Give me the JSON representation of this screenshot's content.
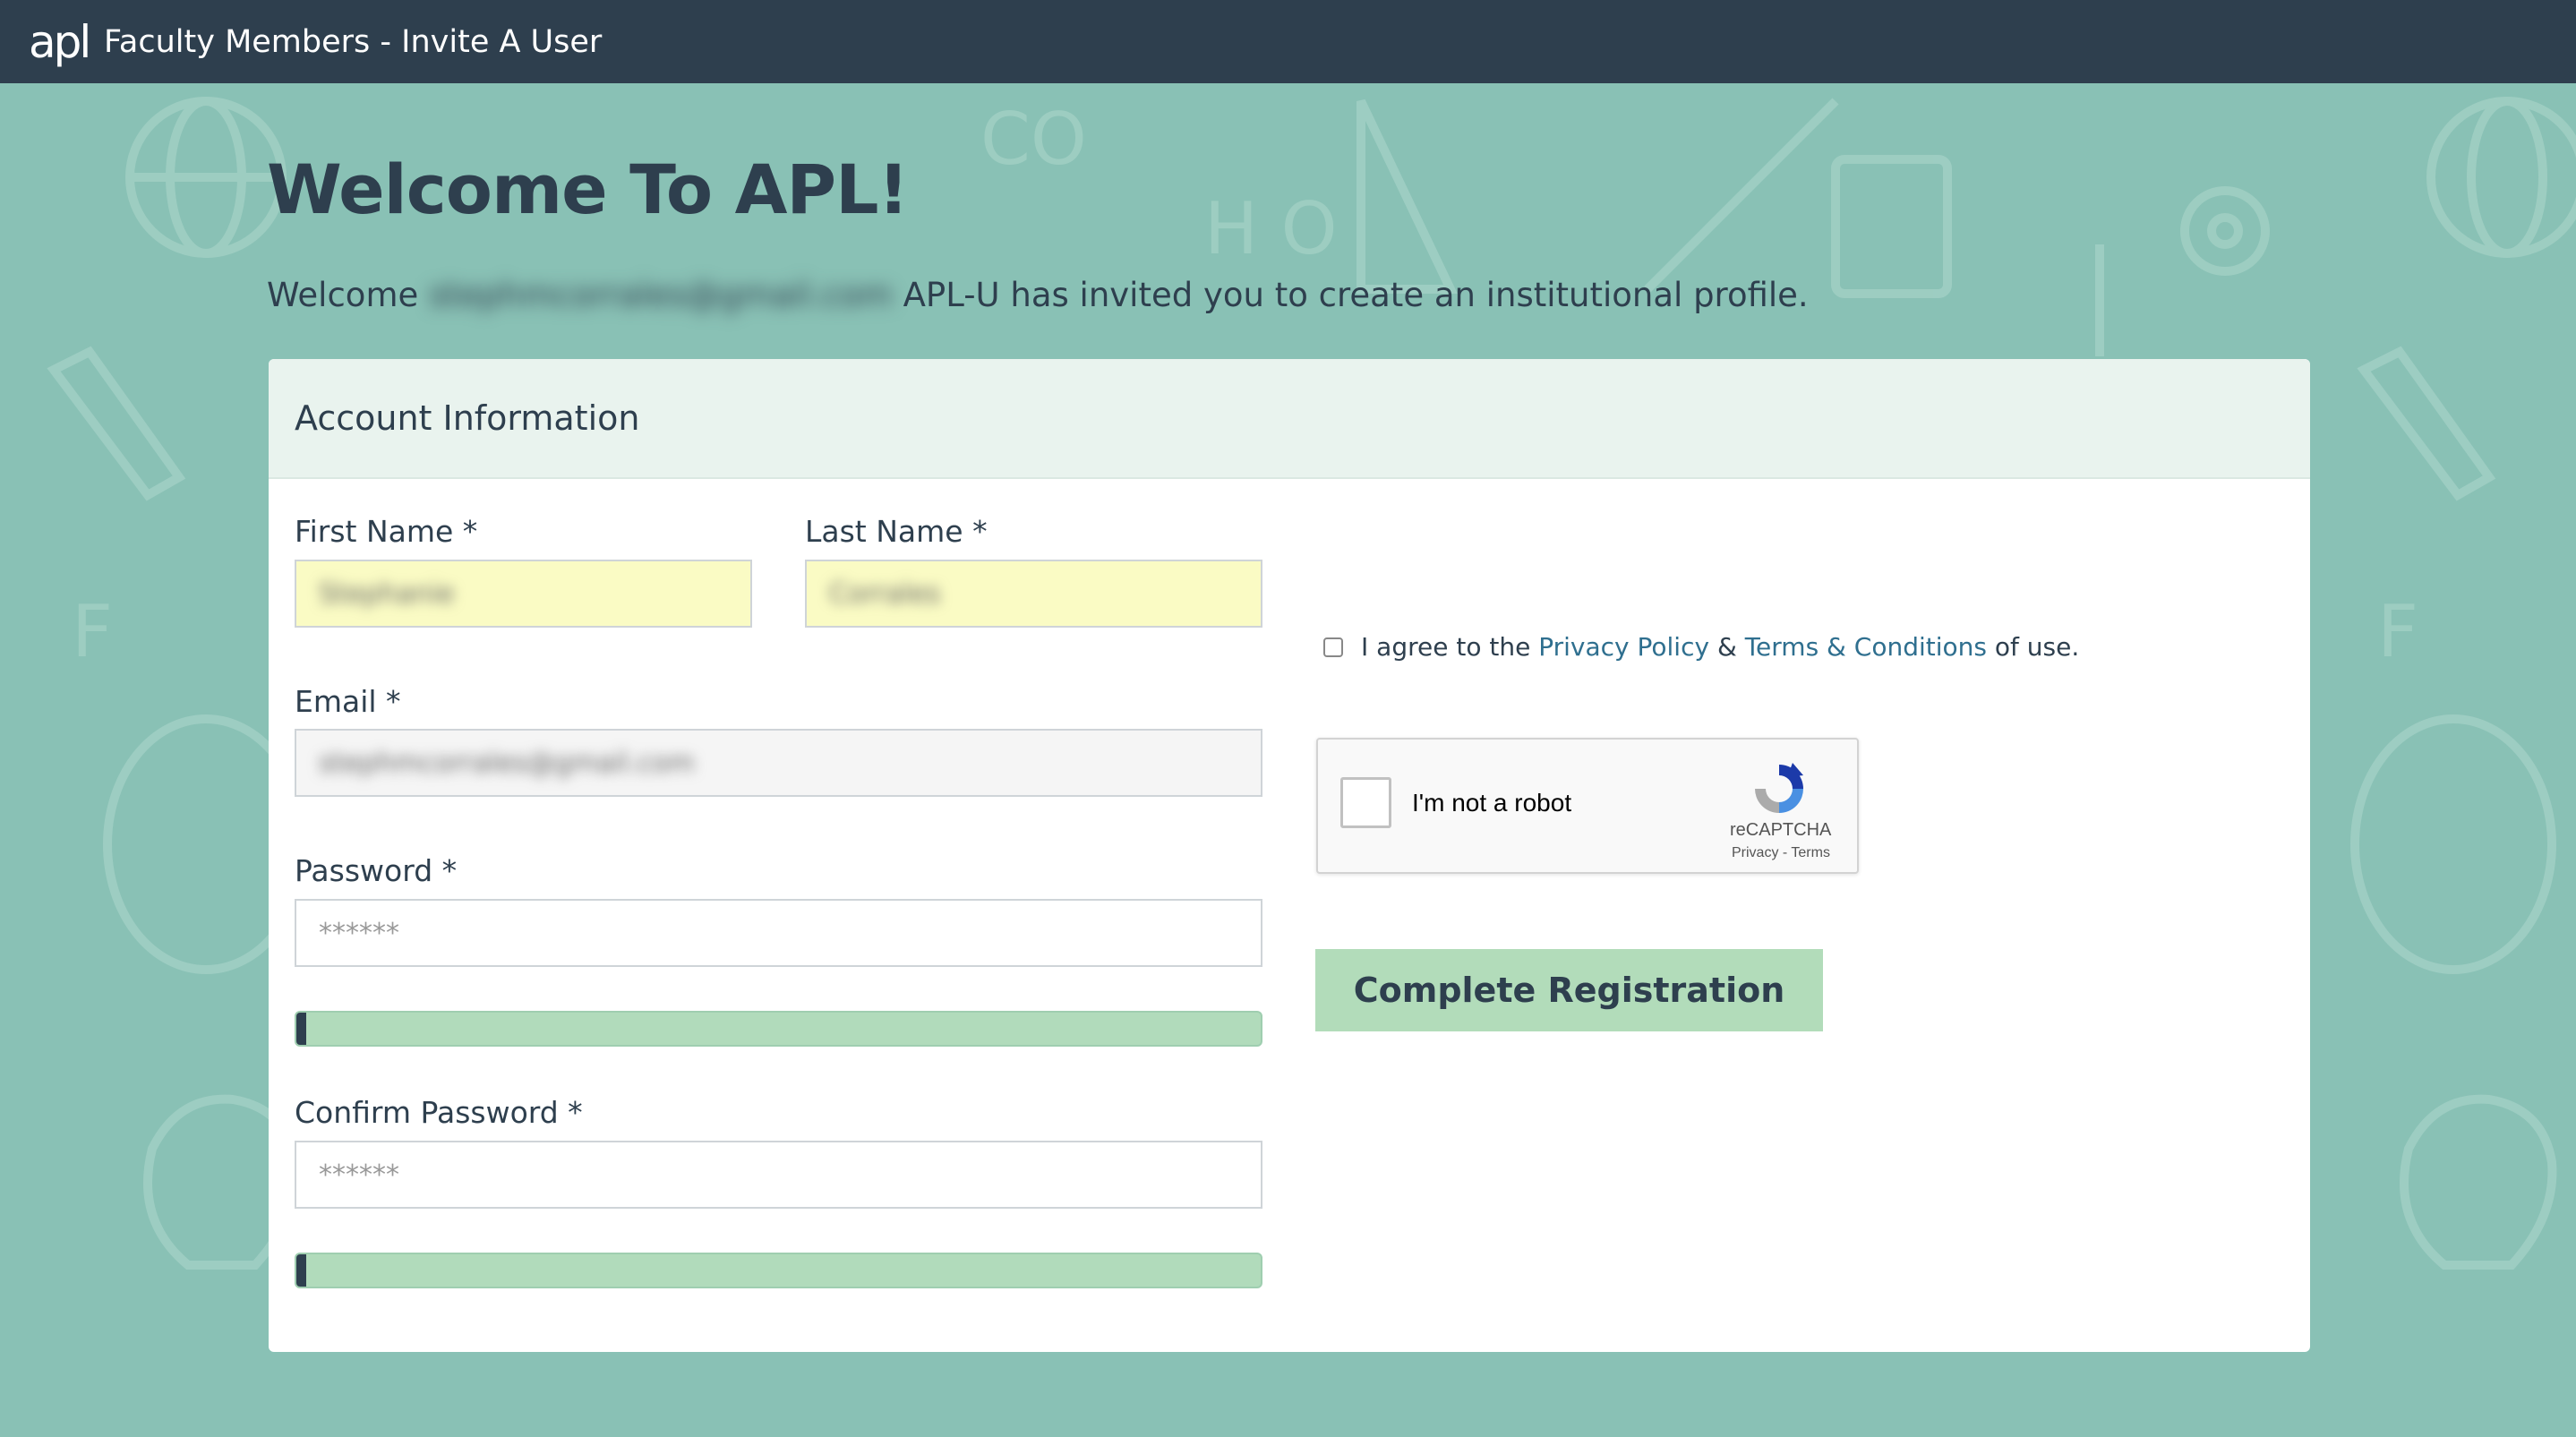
{
  "app": {
    "logo_text": "apl",
    "title": "Faculty Members - Invite A User"
  },
  "page": {
    "heading": "Welcome To APL!",
    "welcome_prefix": "Welcome",
    "welcome_email": "stephmcorrales@gmail.com",
    "welcome_suffix": "APL-U has invited you to create an institutional profile."
  },
  "card": {
    "header": "Account Information"
  },
  "form": {
    "first_name_label": "First Name *",
    "first_name_value": "Stephanie",
    "last_name_label": "Last Name *",
    "last_name_value": "Corrales",
    "email_label": "Email *",
    "email_value": "stephmcorrales@gmail.com",
    "password_label": "Password *",
    "password_placeholder": "******",
    "password_strength": 0.01,
    "confirm_label": "Confirm Password *",
    "confirm_placeholder": "******",
    "confirm_strength": 0.01
  },
  "agreement": {
    "prefix": "I agree to the",
    "privacy_link": "Privacy Policy",
    "ampersand": "&",
    "terms_link": "Terms & Conditions",
    "suffix": "of use."
  },
  "recaptcha": {
    "label": "I'm not a robot",
    "brand": "reCAPTCHA",
    "links": "Privacy - Terms"
  },
  "submit_label": "Complete Registration",
  "colors": {
    "topbar": "#2e3f4e",
    "background": "#89c1b5",
    "button": "#b2dcba",
    "link": "#2f6f8f"
  }
}
